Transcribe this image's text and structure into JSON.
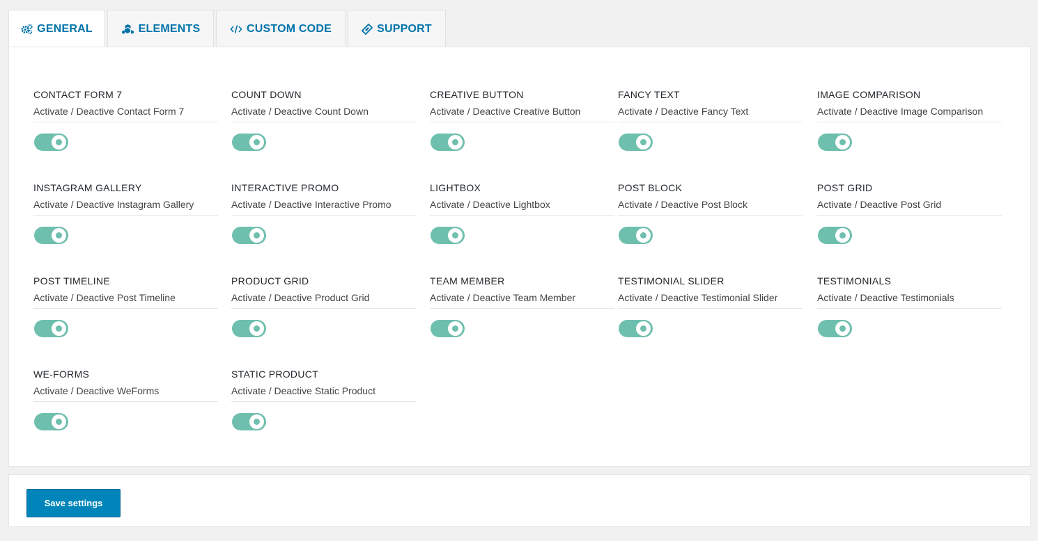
{
  "tabs": [
    {
      "label": "GENERAL",
      "icon": "gears-icon"
    },
    {
      "label": "ELEMENTS",
      "icon": "cubes-icon"
    },
    {
      "label": "CUSTOM CODE",
      "icon": "code-icon"
    },
    {
      "label": "SUPPORT",
      "icon": "ticket-icon"
    }
  ],
  "active_tab": "GENERAL",
  "colors": {
    "accent": "#0073aa",
    "toggle_on": "#6fbfae",
    "button": "#0085ba"
  },
  "elements": [
    {
      "title": "CONTACT FORM 7",
      "desc": "Activate / Deactive Contact Form 7",
      "enabled": true
    },
    {
      "title": "COUNT DOWN",
      "desc": "Activate / Deactive Count Down",
      "enabled": true
    },
    {
      "title": "CREATIVE BUTTON",
      "desc": "Activate / Deactive Creative Button",
      "enabled": true
    },
    {
      "title": "FANCY TEXT",
      "desc": "Activate / Deactive Fancy Text",
      "enabled": true
    },
    {
      "title": "IMAGE COMPARISON",
      "desc": "Activate / Deactive Image Comparison",
      "enabled": true
    },
    {
      "title": "INSTAGRAM GALLERY",
      "desc": "Activate / Deactive Instagram Gallery",
      "enabled": true
    },
    {
      "title": "INTERACTIVE PROMO",
      "desc": "Activate / Deactive Interactive Promo",
      "enabled": true
    },
    {
      "title": "LIGHTBOX",
      "desc": "Activate / Deactive Lightbox",
      "enabled": true
    },
    {
      "title": "POST BLOCK",
      "desc": "Activate / Deactive Post Block",
      "enabled": true
    },
    {
      "title": "POST GRID",
      "desc": "Activate / Deactive Post Grid",
      "enabled": true
    },
    {
      "title": "POST TIMELINE",
      "desc": "Activate / Deactive Post Timeline",
      "enabled": true
    },
    {
      "title": "PRODUCT GRID",
      "desc": "Activate / Deactive Product Grid",
      "enabled": true
    },
    {
      "title": "TEAM MEMBER",
      "desc": "Activate / Deactive Team Member",
      "enabled": true
    },
    {
      "title": "TESTIMONIAL SLIDER",
      "desc": "Activate / Deactive Testimonial Slider",
      "enabled": true
    },
    {
      "title": "TESTIMONIALS",
      "desc": "Activate / Deactive Testimonials",
      "enabled": true
    },
    {
      "title": "WE-FORMS",
      "desc": "Activate / Deactive WeForms",
      "enabled": true
    },
    {
      "title": "STATIC PRODUCT",
      "desc": "Activate / Deactive Static Product",
      "enabled": true
    }
  ],
  "save_label": "Save settings"
}
